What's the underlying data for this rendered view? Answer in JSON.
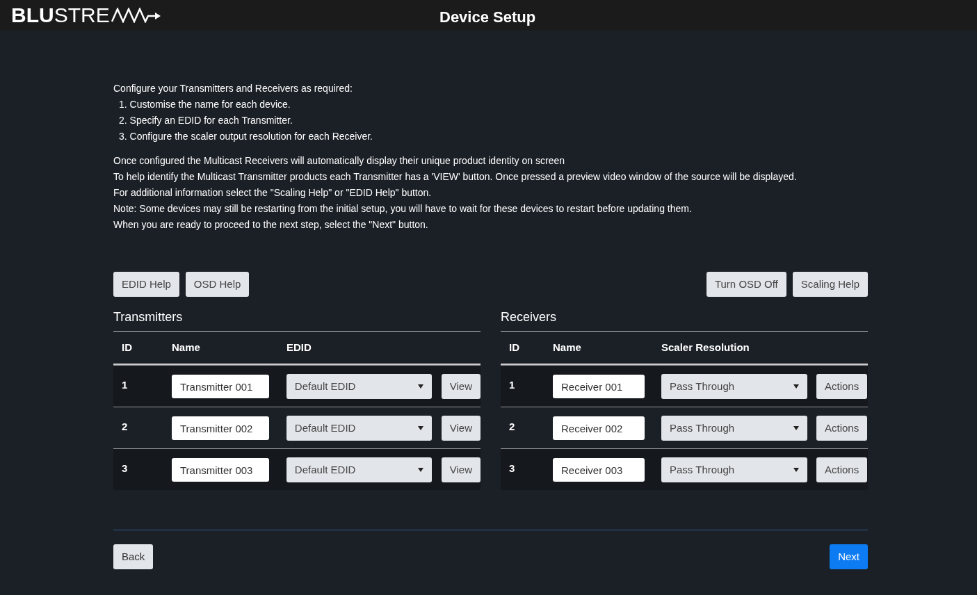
{
  "header": {
    "logo": "**BLU**STRE",
    "title": "Device Setup"
  },
  "intro": {
    "heading": "Configure your Transmitters and Receivers as required:",
    "steps": [
      "1. Customise the name for each device.",
      "2. Specify an EDID for each Transmitter.",
      "3. Configure the scaler output resolution for each Receiver."
    ],
    "paragraphs": [
      "Once configured the Multicast Receivers will automatically display their unique product identity on screen",
      "To help identify the Multicast Transmitter products each Transmitter has a 'VIEW' button. Once pressed a preview video window of the source will be displayed.",
      "For additional information select the \"Scaling Help\" or \"EDID Help\" button.",
      "Note: Some devices may still be restarting from the initial setup, you will have to wait for these devices to restart before updating them.",
      "When you are ready to proceed to the next step, select the \"Next\" button."
    ]
  },
  "left_buttons": [
    "EDID Help",
    "OSD Help"
  ],
  "right_buttons": [
    "Turn OSD Off",
    "Scaling Help"
  ],
  "transmitters": {
    "title": "Transmitters",
    "columns": [
      "ID",
      "Name",
      "EDID"
    ],
    "rows": [
      {
        "id": "1",
        "name": "Transmitter 001",
        "select": "Default EDID",
        "action": "View"
      },
      {
        "id": "2",
        "name": "Transmitter 002",
        "select": "Default EDID",
        "action": "View"
      },
      {
        "id": "3",
        "name": "Transmitter 003",
        "select": "Default EDID",
        "action": "View"
      }
    ]
  },
  "receivers": {
    "title": "Receivers",
    "columns": [
      "ID",
      "Name",
      "Scaler Resolution"
    ],
    "rows": [
      {
        "id": "1",
        "name": "Receiver 001",
        "select": "Pass Through",
        "action": "Actions"
      },
      {
        "id": "2",
        "name": "Receiver 002",
        "select": "Pass Through",
        "action": "Actions"
      },
      {
        "id": "3",
        "name": "Receiver 003",
        "select": "Pass Through",
        "action": "Actions"
      }
    ]
  },
  "footer": {
    "back": "Back",
    "next": "Next"
  }
}
